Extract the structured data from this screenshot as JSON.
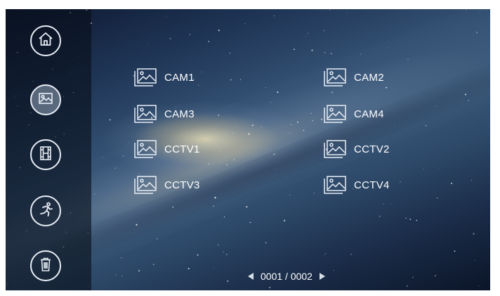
{
  "sidebar": {
    "buttons": [
      {
        "icon": "home-icon",
        "active": false
      },
      {
        "icon": "picture-icon",
        "active": true
      },
      {
        "icon": "film-icon",
        "active": false
      },
      {
        "icon": "motion-icon",
        "active": false
      },
      {
        "icon": "trash-icon",
        "active": false
      }
    ]
  },
  "folders": {
    "items": [
      {
        "label": "CAM1"
      },
      {
        "label": "CAM2"
      },
      {
        "label": "CAM3"
      },
      {
        "label": "CAM4"
      },
      {
        "label": "CCTV1"
      },
      {
        "label": "CCTV2"
      },
      {
        "label": "CCTV3"
      },
      {
        "label": "CCTV4"
      }
    ]
  },
  "pager": {
    "text": "0001 / 0002"
  },
  "colors": {
    "text": "#ffffff",
    "icon_stroke": "#e8eef6",
    "active_button": "#96a5b9",
    "sidebar_bg": "#080e1a"
  }
}
